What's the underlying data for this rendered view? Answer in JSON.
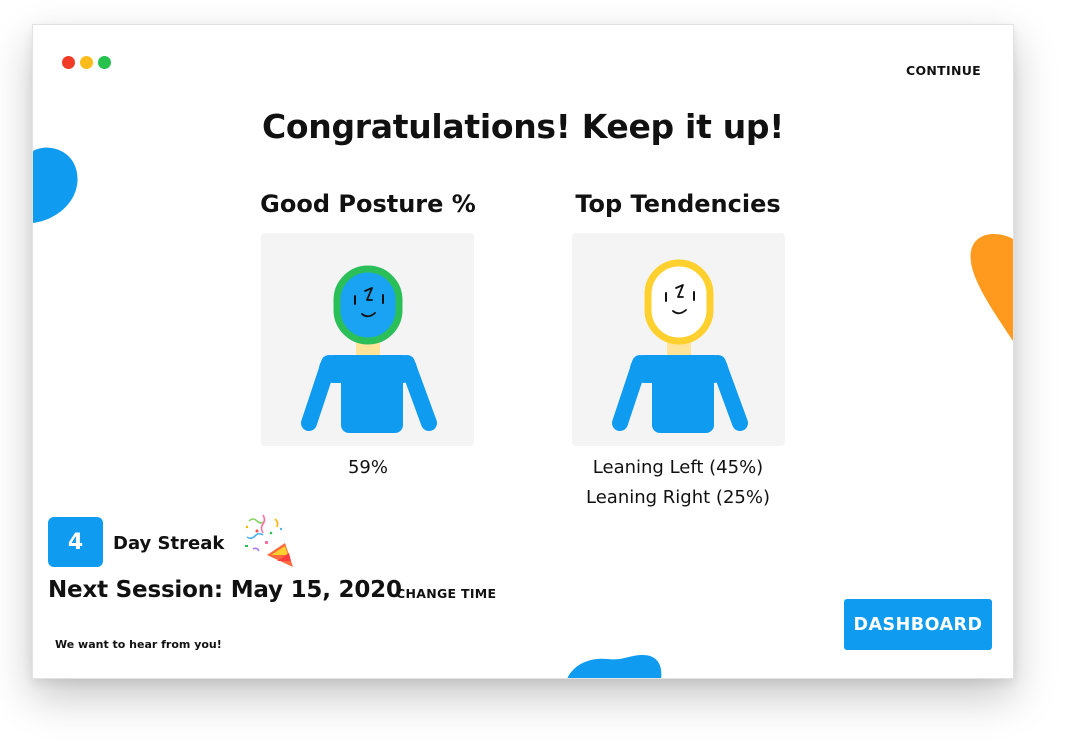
{
  "window": {
    "traffic_lights": [
      "close",
      "minimize",
      "maximize"
    ]
  },
  "header": {
    "continue_label": "CONTINUE"
  },
  "main": {
    "headline": "Congratulations! Keep it up!",
    "posture": {
      "title": "Good Posture %",
      "value": "59%",
      "face_ring_color": "#2bbf5a",
      "face_fill_color": "#1aa3f2"
    },
    "tendencies": {
      "title": "Top Tendencies",
      "items": [
        "Leaning Left (45%)",
        "Leaning Right (25%)"
      ],
      "face_ring_color": "#ffd02e",
      "face_fill_color": "#ffffff"
    }
  },
  "streak": {
    "count": "4",
    "label": "Day Streak",
    "icon": "party-popper-icon"
  },
  "session": {
    "next_label": "Next Session: May 15, 2020",
    "change_label": "CHANGE TIME"
  },
  "footer": {
    "feedback_label": "We want to hear from you!",
    "dashboard_label": "DASHBOARD"
  },
  "colors": {
    "accent": "#0f9bf0",
    "orange": "#ff9a1f",
    "body": "#0f9bf0",
    "neck": "#ffe49a",
    "card_bg": "#f4f4f4"
  }
}
